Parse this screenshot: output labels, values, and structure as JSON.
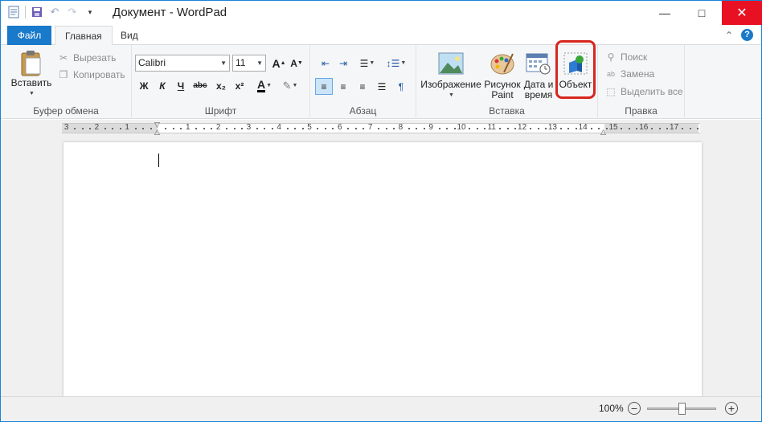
{
  "window": {
    "title": "Документ - WordPad",
    "minimize_glyph": "—",
    "maximize_glyph": "□",
    "close_glyph": "✕"
  },
  "qat": {
    "icons": [
      "wordpad-doc-icon",
      "save-icon",
      "undo-icon",
      "redo-icon",
      "customize-qat-icon"
    ]
  },
  "tabs": {
    "file": "Файл",
    "home": "Главная",
    "view": "Вид"
  },
  "ribbon": {
    "clipboard": {
      "label": "Буфер обмена",
      "paste": "Вставить",
      "cut": "Вырезать",
      "copy": "Копировать"
    },
    "font": {
      "label": "Шрифт",
      "family": "Calibri",
      "size": "11",
      "bold": "Ж",
      "italic": "К",
      "underline": "Ч",
      "strike": "abc",
      "subscript": "x₂",
      "superscript": "x²"
    },
    "paragraph": {
      "label": "Абзац"
    },
    "insert": {
      "label": "Вставка",
      "image": "Изображение",
      "paint_line1": "Рисунок",
      "paint_line2": "Paint",
      "datetime_line1": "Дата и",
      "datetime_line2": "время",
      "object": "Объект"
    },
    "editing": {
      "label": "Правка",
      "find": "Поиск",
      "replace": "Замена",
      "select_all": "Выделить все"
    }
  },
  "ruler": {
    "left_labels": [
      "3",
      "2",
      "1"
    ],
    "right_labels": [
      "1",
      "2",
      "3",
      "4",
      "5",
      "6",
      "7",
      "8",
      "9",
      "10",
      "11",
      "12",
      "13",
      "14",
      "15",
      "16",
      "17"
    ]
  },
  "status": {
    "zoom": "100%",
    "zoom_level": 1.0
  },
  "colors": {
    "accent": "#1979ca",
    "highlight": "#d7261e",
    "close": "#e81123"
  }
}
